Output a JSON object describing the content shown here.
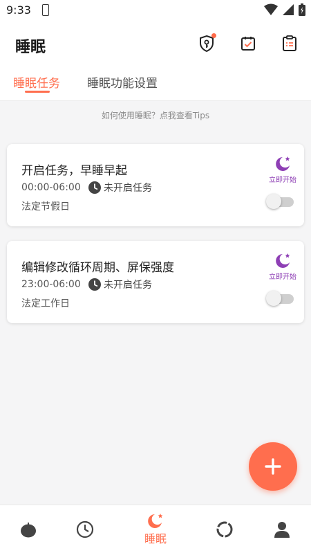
{
  "status_bar": {
    "time": "9:33",
    "icons": [
      "phone-icon",
      "wifi-icon",
      "cell-signal-icon",
      "battery-icon"
    ]
  },
  "app_bar": {
    "title": "睡眠",
    "actions": [
      "shield-key-icon",
      "calendar-check-icon",
      "clipboard-list-icon"
    ]
  },
  "tabs": [
    {
      "label": "睡眠任务",
      "active": true
    },
    {
      "label": "睡眠功能设置",
      "active": false
    }
  ],
  "tips": "如何使用睡眠？点我查看Tips",
  "tasks": [
    {
      "title": "开启任务，早睡早起",
      "time": "00:00-06:00",
      "status": "未开启任务",
      "days": "法定节假日",
      "start_label": "立即开始",
      "enabled": false
    },
    {
      "title": "编辑修改循环周期、屏保强度",
      "time": "23:00-06:00",
      "status": "未开启任务",
      "days": "法定工作日",
      "start_label": "立即开始",
      "enabled": false
    }
  ],
  "fab": {
    "icon": "plus-icon"
  },
  "bottom_nav": [
    {
      "icon": "tomato-icon",
      "label": ""
    },
    {
      "icon": "clock-icon",
      "label": ""
    },
    {
      "icon": "moon-star-icon",
      "label": "睡眠",
      "active": true
    },
    {
      "icon": "circle-progress-icon",
      "label": ""
    },
    {
      "icon": "user-icon",
      "label": ""
    }
  ],
  "colors": {
    "accent": "#ff6e4e",
    "purple": "#8e3fb5",
    "background": "#f5f5f6"
  }
}
